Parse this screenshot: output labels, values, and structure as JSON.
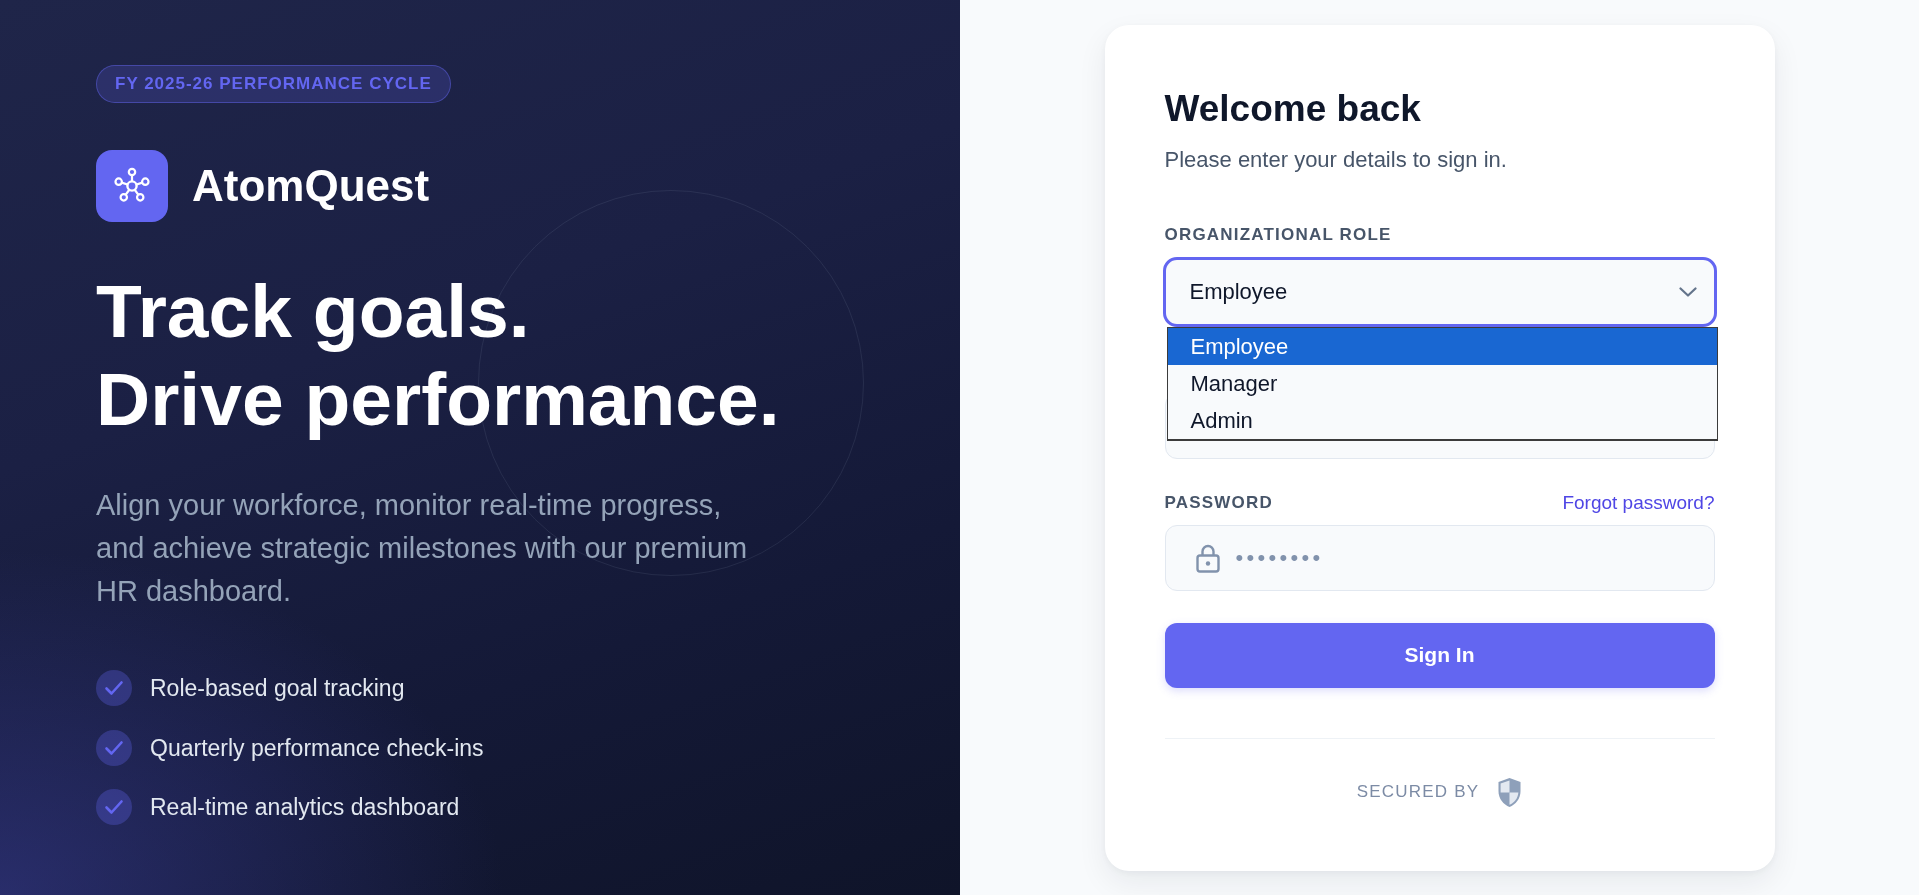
{
  "brand_panel": {
    "badge": "FY 2025-26 PERFORMANCE CYCLE",
    "logo_text": "AtomQuest",
    "headline": [
      "Track goals.",
      "Drive performance."
    ],
    "description": "Align your workforce, monitor real-time progress, and achieve strategic milestones with our premium HR dashboard.",
    "features": [
      "Role-based goal tracking",
      "Quarterly performance check-ins",
      "Real-time analytics dashboard"
    ]
  },
  "login_card": {
    "title": "Welcome back",
    "subtitle": "Please enter your details to sign in.",
    "fields": [
      {
        "kind": "select",
        "label": "ORGANIZATIONAL ROLE",
        "value": "Employee",
        "focused": true,
        "expanded": true,
        "options": [
          {
            "label": "Employee",
            "selected": true
          },
          {
            "label": "Manager",
            "selected": false
          },
          {
            "label": "Admin",
            "selected": false
          }
        ]
      },
      {
        "kind": "text"
      },
      {
        "kind": "password",
        "label": "PASSWORD",
        "link": "Forgot password?",
        "value": "••••••••"
      }
    ],
    "submit_button": "Sign In",
    "footer_text": "SECURED BY"
  }
}
